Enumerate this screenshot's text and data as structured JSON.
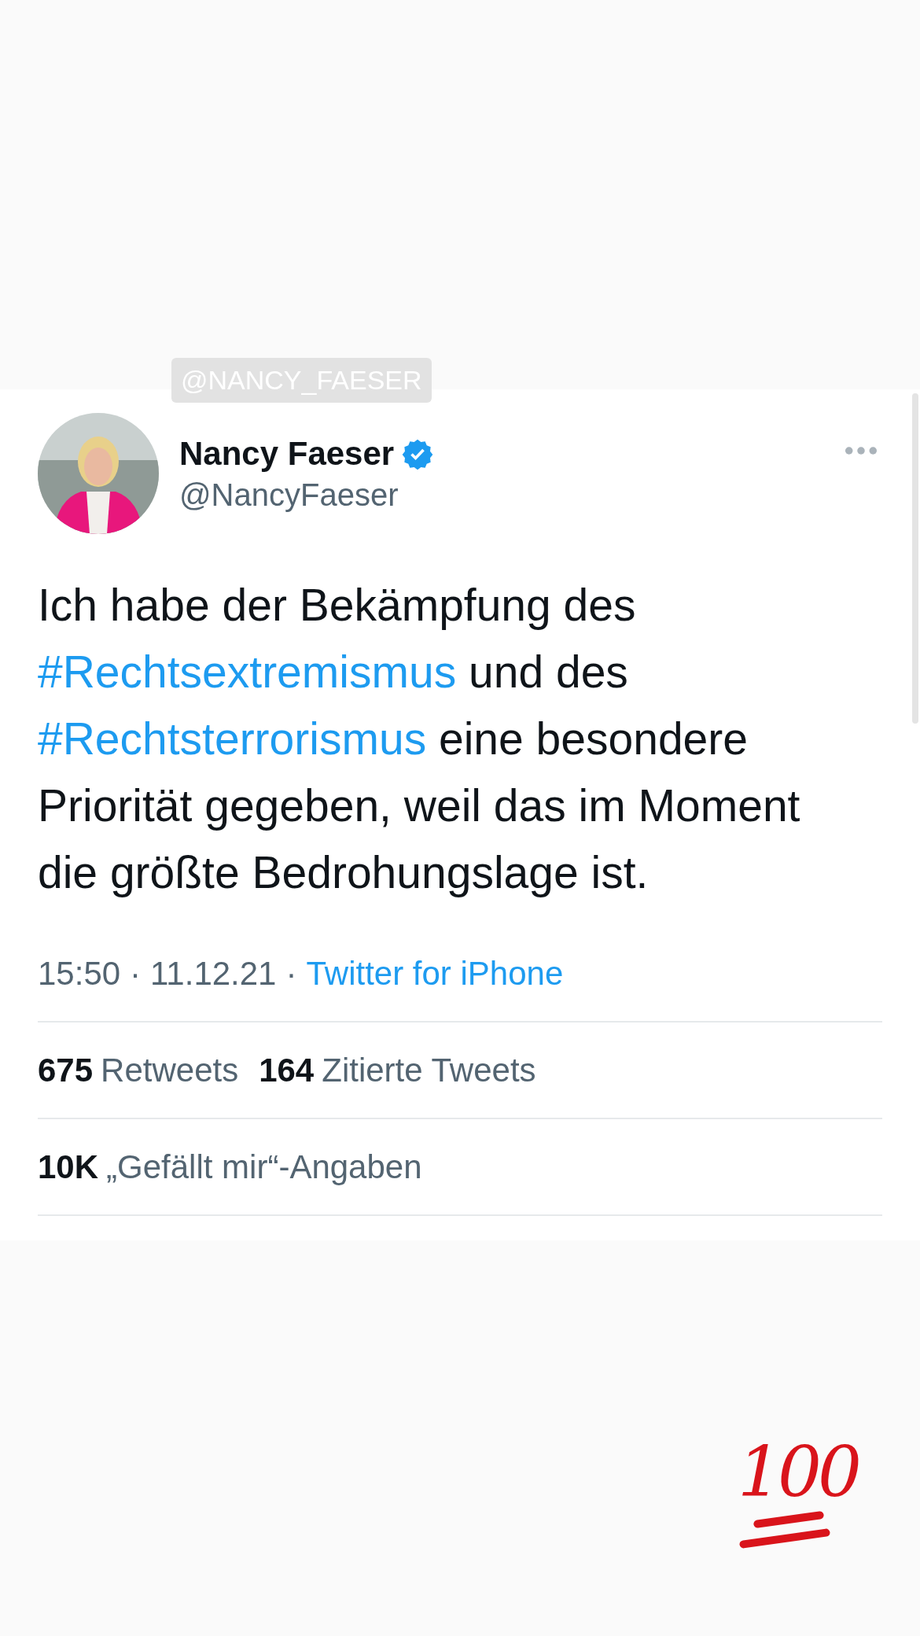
{
  "mention_sticker": {
    "text": "@NANCY_FAESER"
  },
  "tweet": {
    "author": {
      "name": "Nancy Faeser",
      "verified": true,
      "handle": "@NancyFaeser"
    },
    "body": [
      {
        "kind": "plain",
        "text": "Ich habe der Bekämpfung des "
      },
      {
        "kind": "hashtag",
        "text": "#Rechtsextremismus"
      },
      {
        "kind": "plain",
        "text": " und des "
      },
      {
        "kind": "hashtag",
        "text": "#Rechtsterrorismus"
      },
      {
        "kind": "plain",
        "text": " eine besondere Priorität gegeben, weil das im Moment die größte Bedrohungslage ist."
      }
    ],
    "meta": {
      "time": "15:50",
      "separator_1": "·",
      "date": "11.12.21",
      "separator_2": "·",
      "source": "Twitter for iPhone"
    },
    "stats": [
      {
        "count": "675",
        "label": "Retweets"
      },
      {
        "count": "164",
        "label": "Zitierte Tweets"
      }
    ],
    "likes": {
      "count": "10K",
      "label": "„Gefällt mir“-Angaben"
    }
  },
  "sticker": {
    "text": "100"
  }
}
